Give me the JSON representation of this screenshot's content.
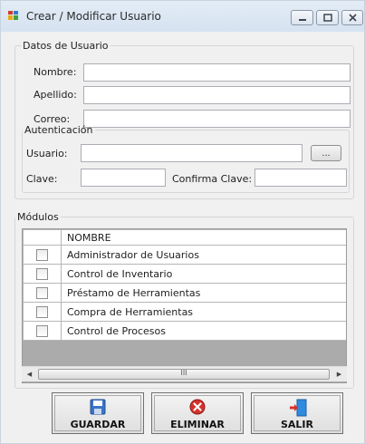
{
  "window": {
    "title": "Crear / Modificar Usuario"
  },
  "datos": {
    "legend": "Datos de Usuario",
    "nombre_label": "Nombre:",
    "nombre_value": "",
    "apellido_label": "Apellido:",
    "apellido_value": "",
    "correo_label": "Correo:",
    "correo_value": ""
  },
  "autenticacion": {
    "legend": "Autenticación",
    "usuario_label": "Usuario:",
    "usuario_value": "",
    "browse_label": "...",
    "clave_label": "Clave:",
    "clave_value": "",
    "confirma_label": "Confirma Clave:",
    "confirma_value": ""
  },
  "modulos": {
    "legend": "Módulos",
    "column_header": "NOMBRE",
    "rows": [
      {
        "name": "Administrador de Usuarios",
        "checked": false
      },
      {
        "name": "Control de Inventario",
        "checked": false
      },
      {
        "name": "Préstamo de Herramientas",
        "checked": false
      },
      {
        "name": "Compra de Herramientas",
        "checked": false
      },
      {
        "name": "Control de Procesos",
        "checked": false
      }
    ],
    "scroll_thumb_glyph": "III"
  },
  "buttons": {
    "guardar": "GUARDAR",
    "eliminar": "ELIMINAR",
    "salir": "SALIR"
  },
  "icons": {
    "guardar": "floppy-disk-icon",
    "eliminar": "red-x-circle-icon",
    "salir": "exit-door-icon"
  }
}
